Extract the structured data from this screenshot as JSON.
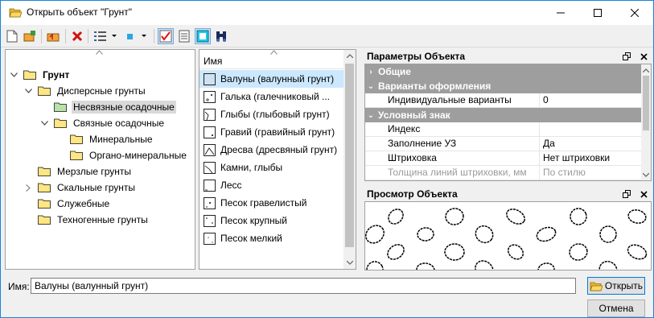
{
  "window": {
    "title": "Открыть объект \"Грунт\""
  },
  "toolbar": {
    "icons": [
      "new-doc-icon",
      "add-folder-icon",
      "open-folder-up-icon",
      "delete-icon",
      "view-list-icon",
      "color-square-icon",
      "check-icon",
      "text-doc-icon",
      "highlight-icon",
      "binoculars-icon"
    ]
  },
  "tree": {
    "items": [
      {
        "label": "Грунт",
        "level": 0,
        "expanded": true,
        "bold": true
      },
      {
        "label": "Дисперсные грунты",
        "level": 1,
        "expanded": true
      },
      {
        "label": "Несвязные осадочные",
        "level": 2,
        "selected": true
      },
      {
        "label": "Связные осадочные",
        "level": 2,
        "expanded": true
      },
      {
        "label": "Минеральные",
        "level": 3
      },
      {
        "label": "Органо-минеральные",
        "level": 3
      },
      {
        "label": "Мерзлые грунты",
        "level": 1
      },
      {
        "label": "Скальные грунты",
        "level": 1,
        "collapsed": true
      },
      {
        "label": "Служебные",
        "level": 1
      },
      {
        "label": "Техногенные грунты",
        "level": 1
      }
    ]
  },
  "list": {
    "header": "Имя",
    "items": [
      {
        "label": "Валуны (валунный грунт)",
        "selected": true
      },
      {
        "label": "Галька (галечниковый ..."
      },
      {
        "label": "Глыбы (глыбовый грунт)"
      },
      {
        "label": "Гравий (гравийный грунт)"
      },
      {
        "label": "Дресва (дресвяный грунт)"
      },
      {
        "label": "Камни, глыбы"
      },
      {
        "label": "Лесс"
      },
      {
        "label": "Песок гравелистый"
      },
      {
        "label": "Песок крупный"
      },
      {
        "label": "Песок мелкий"
      }
    ]
  },
  "properties": {
    "title": "Параметры Объекта",
    "categories": {
      "general": "Общие",
      "design": "Варианты оформления",
      "symbol": "Условный знак"
    },
    "rows": {
      "individual": {
        "name": "Индивидуальные варианты",
        "value": "0"
      },
      "index": {
        "name": "Индекс",
        "value": ""
      },
      "fill": {
        "name": "Заполнение УЗ",
        "value": "Да"
      },
      "hatch": {
        "name": "Штриховка",
        "value": "Нет штриховки"
      },
      "line_width": {
        "name": "Толщина линий штриховки, мм",
        "value": "По стилю"
      }
    }
  },
  "preview": {
    "title": "Просмотр Объекта"
  },
  "bottom": {
    "name_label": "Имя:",
    "name_value": "Валуны (валунный грунт)",
    "open_label": "Открыть",
    "cancel_label": "Отмена"
  },
  "colors": {
    "accent": "#0078d7",
    "selected_list": "#cce8ff",
    "category_bg": "#9e9e9e",
    "folder": "#ffe680"
  }
}
